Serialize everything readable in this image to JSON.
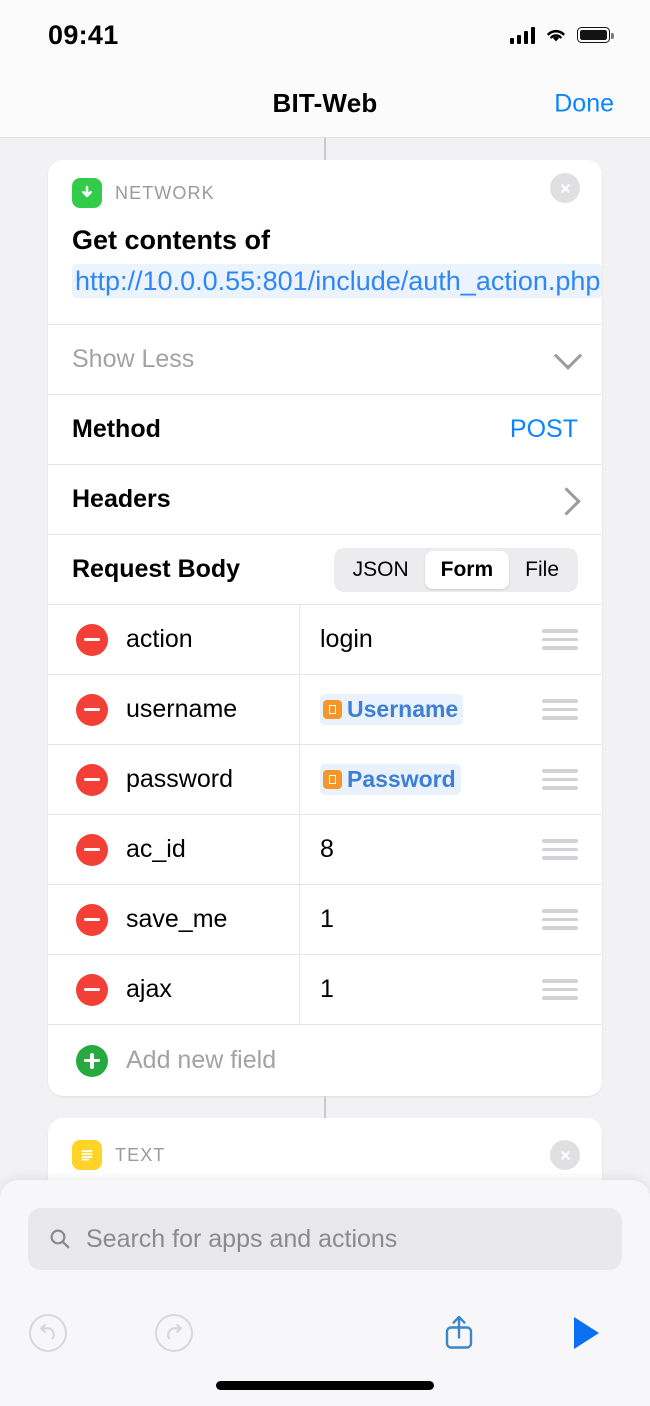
{
  "status_bar": {
    "time": "09:41",
    "icons": [
      "cellular-signal-icon",
      "wifi-icon",
      "battery-icon"
    ]
  },
  "nav_bar": {
    "title": "BIT-Web",
    "done_label": "Done"
  },
  "colors": {
    "accent_blue": "#0a84ff",
    "link_blue": "#2f87f6",
    "network_green": "#33cc4a",
    "text_yellow": "#ffd426",
    "remove_red": "#f43f36",
    "add_green": "#28a93f",
    "variable_orange": "#f5962a",
    "canvas_gray": "#f2f2f4"
  },
  "actions": [
    {
      "category": "NETWORK",
      "icon": "download-arrow-icon",
      "title_prefix": "Get contents of",
      "url": "http://10.0.0.55:801/include/auth_action.php",
      "disclosure_label": "Show Less",
      "rows": [
        {
          "label": "Method",
          "value": "POST"
        },
        {
          "label": "Headers",
          "value": ""
        }
      ],
      "request_body": {
        "label": "Request Body",
        "segments": [
          "JSON",
          "Form",
          "File"
        ],
        "selected": "Form",
        "fields": [
          {
            "key": "action",
            "value": "login",
            "value_type": "text"
          },
          {
            "key": "username",
            "value": "Username",
            "value_type": "variable"
          },
          {
            "key": "password",
            "value": "Password",
            "value_type": "variable"
          },
          {
            "key": "ac_id",
            "value": "8",
            "value_type": "text"
          },
          {
            "key": "save_me",
            "value": "1",
            "value_type": "text"
          },
          {
            "key": "ajax",
            "value": "1",
            "value_type": "text"
          }
        ],
        "add_field_label": "Add new field"
      }
    },
    {
      "category": "TEXT",
      "icon": "text-lines-icon"
    }
  ],
  "sheet": {
    "search_placeholder": "Search for apps and actions",
    "toolbar": [
      {
        "name": "undo-button",
        "enabled": false
      },
      {
        "name": "redo-button",
        "enabled": false
      },
      {
        "name": "share-button",
        "enabled": true
      },
      {
        "name": "run-button",
        "enabled": true
      }
    ]
  }
}
